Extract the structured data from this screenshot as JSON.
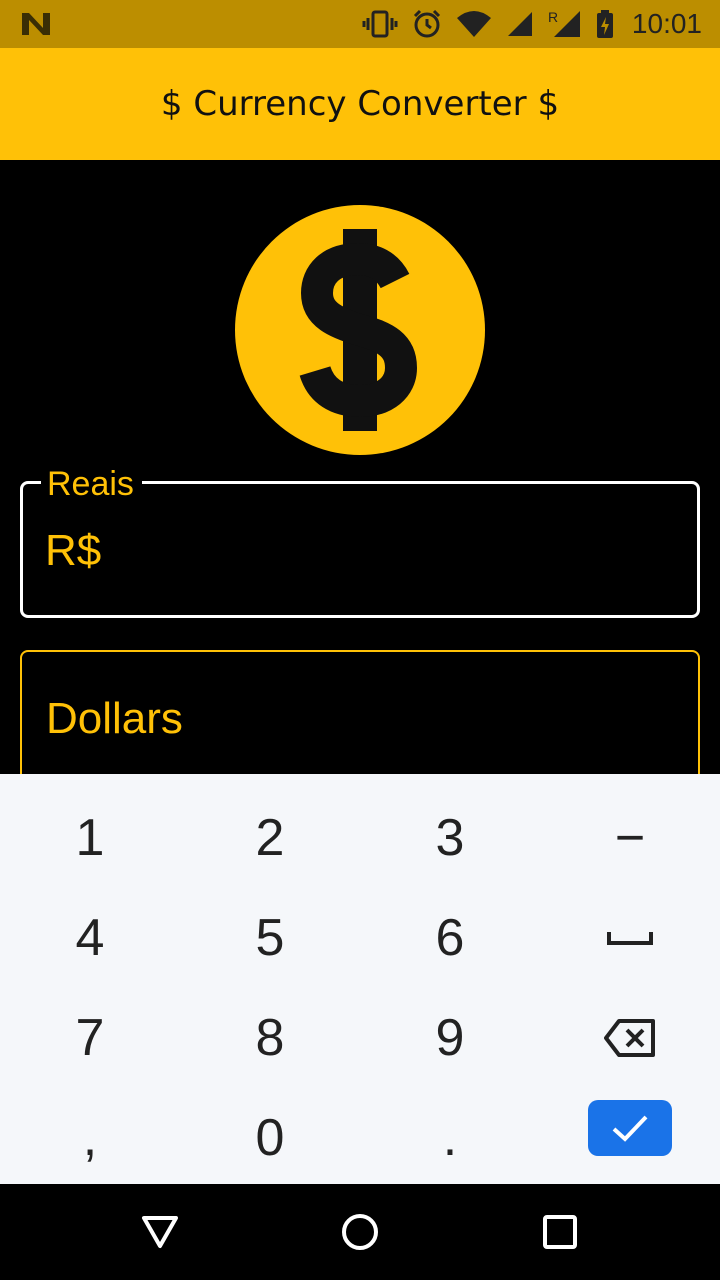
{
  "status_bar": {
    "time": "10:01",
    "roaming": "R",
    "icons": [
      "n-logo-icon",
      "vibrate-icon",
      "alarm-icon",
      "wifi-icon",
      "signal-icon",
      "roaming-signal-icon",
      "battery-charging-icon"
    ]
  },
  "app_bar": {
    "title": "$ Currency Converter $"
  },
  "hero": {
    "icon": "dollar-coin-icon",
    "color": "#FFC107"
  },
  "form": {
    "reais": {
      "label": "Reais",
      "prefix": "R$",
      "value": ""
    },
    "dollars": {
      "label": "Dollars",
      "value": ""
    }
  },
  "keyboard": {
    "rows": [
      [
        "1",
        "2",
        "3",
        "−"
      ],
      [
        "4",
        "5",
        "6",
        "space"
      ],
      [
        "7",
        "8",
        "9",
        "backspace"
      ],
      [
        ",",
        "0",
        ".",
        "enter"
      ]
    ],
    "enter_color": "#1A73E8"
  },
  "nav_bar": {
    "icons": [
      "back-triangle-icon",
      "home-circle-icon",
      "recents-square-icon"
    ]
  },
  "colors": {
    "accent": "#FFC107",
    "status_bar": "#BC8E00",
    "background": "#000000"
  }
}
